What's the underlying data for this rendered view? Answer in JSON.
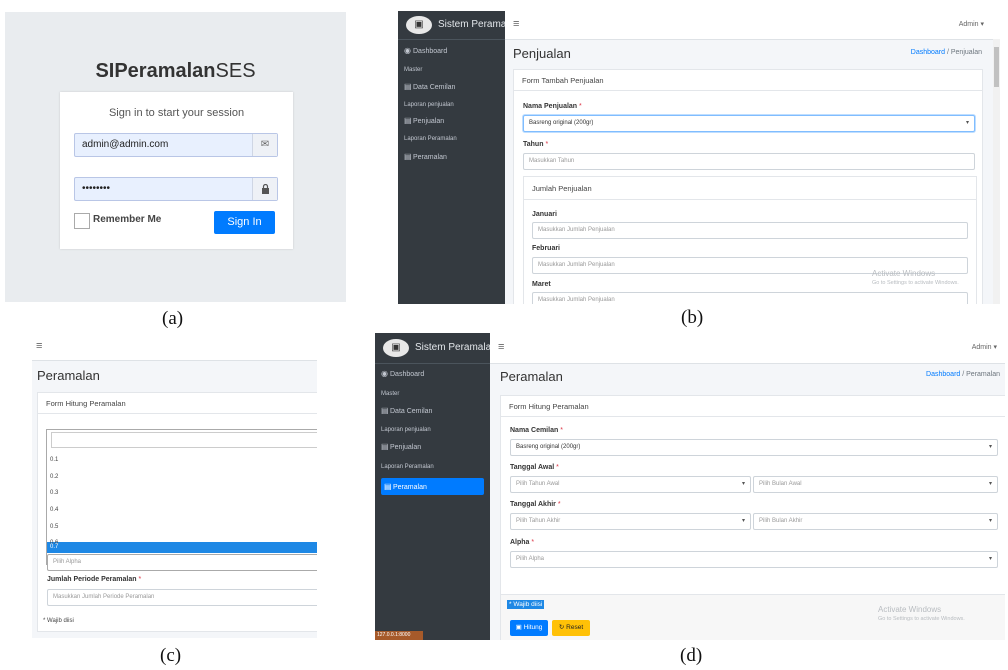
{
  "captions": [
    "(a)",
    "(b)",
    "(c)",
    "(d)"
  ],
  "login": {
    "brand_bold": "SIPeramalan",
    "brand_rest": "SES",
    "message": "Sign in to start your session",
    "email_value": "admin@admin.com",
    "password_value": "••••••••",
    "remember_label": "Remember Me",
    "signin_label": "Sign In",
    "colors": {
      "primary": "#007bff",
      "background": "#e9ecef"
    }
  },
  "app": {
    "title": "Sistem Peramalan",
    "user_menu": "Admin ▾",
    "sidebar": {
      "dashboard": "Dashboard",
      "master_header": "Master",
      "data_cemilan": "Data Cemilan",
      "laporan_penjualan_header": "Laporan penjualan",
      "penjualan": "Penjualan",
      "laporan_peramalan_header": "Laporan Peramalan",
      "peramalan": "Peramalan"
    },
    "watermark_title": "Activate Windows",
    "watermark_sub": "Go to Settings to activate Windows.",
    "colors": {
      "sidebar": "#343a40",
      "active": "#007bff",
      "required": "#dc3545",
      "warning": "#ffc107"
    }
  },
  "penjualan": {
    "page_title": "Penjualan",
    "crumb_home": "Dashboard",
    "crumb_current": "Penjualan",
    "card_title": "Form Tambah Penjualan",
    "nama_label": "Nama Penjualan",
    "nama_value": "Basreng original (200gr)",
    "tahun_label": "Tahun",
    "tahun_placeholder": "Masukkan Tahun",
    "jumlah_title": "Jumlah Penjualan",
    "januari": "Januari",
    "februari": "Februari",
    "maret": "Maret",
    "jumlah_placeholder": "Masukkan Jumlah Penjualan"
  },
  "peramalan_dropdown": {
    "page_title": "Peramalan",
    "card_title": "Form Hitung Peramalan",
    "options": [
      "0.1",
      "0.2",
      "0.3",
      "0.4",
      "0.5",
      "0.6",
      "0.7"
    ],
    "selected": "0.7",
    "alpha_placeholder": "Pilih Alpha",
    "periode_label": "Jumlah Periode Peramalan",
    "periode_placeholder": "Masukkan Jumlah Periode Peramalan",
    "wajib": "* Wajib diisi"
  },
  "peramalan": {
    "page_title": "Peramalan",
    "crumb_home": "Dashboard",
    "crumb_current": "Peramalan",
    "card_title": "Form Hitung Peramalan",
    "cemilan_label": "Nama Cemilan",
    "cemilan_value": "Basreng original (200gr)",
    "awal_label": "Tanggal Awal",
    "tahun_awal": "Pilih Tahun Awal",
    "bulan_awal": "Pilih Bulan Awal",
    "akhir_label": "Tanggal Akhir",
    "tahun_akhir": "Pilih Tahun Akhir",
    "bulan_akhir": "Pilih Bulan Akhir",
    "alpha_label": "Alpha",
    "alpha_placeholder": "Pilih Alpha",
    "wajib": "* Wajib diisi",
    "hitung_label": "Hitung",
    "reset_label": "Reset",
    "status_url": "127.0.0.1:8000"
  }
}
